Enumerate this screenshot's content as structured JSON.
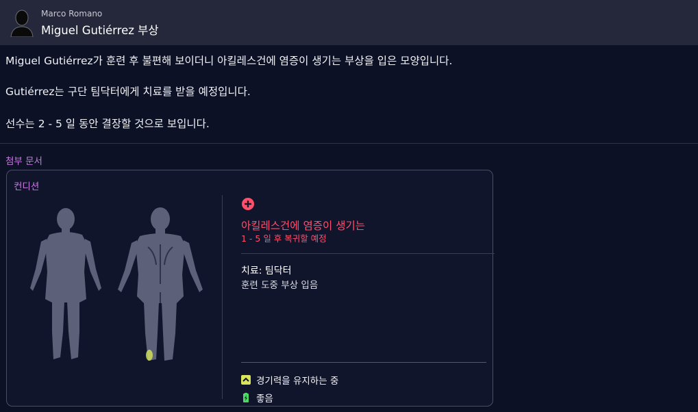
{
  "header": {
    "sender": "Marco Romano",
    "subject": "Miguel Gutiérrez 부상",
    "avatar_icon": "person-silhouette-icon"
  },
  "message": {
    "paragraphs": [
      "Miguel Gutiérrez가 훈련 후 불편해 보이더니 아킬레스건에 염증이 생기는 부상을 입은 모양입니다.",
      "Gutiérrez는 구단 팀닥터에게 치료를 받을 예정입니다.",
      "선수는 2 - 5 일 동안 결장할 것으로 보입니다."
    ]
  },
  "attachments": {
    "label": "첨부 문서"
  },
  "condition_card": {
    "title": "컨디션",
    "injury_icon": "plus-circle-icon",
    "injury_name": "아킬레스건에 염증이 생기는",
    "return_estimate": "1 - 5 일 후 복귀할 예정",
    "treatment": "치료:  팀닥터",
    "cause": "훈련 도중 부상 입음",
    "statuses": [
      {
        "icon": "chevron-up-icon",
        "label": "경기력을 유지하는 중"
      },
      {
        "icon": "battery-icon",
        "label": "좋음"
      }
    ],
    "colors": {
      "injury": "#ff4f6a",
      "accent_purple": "#c77be0",
      "injury_spot": "#d7e65a"
    }
  }
}
